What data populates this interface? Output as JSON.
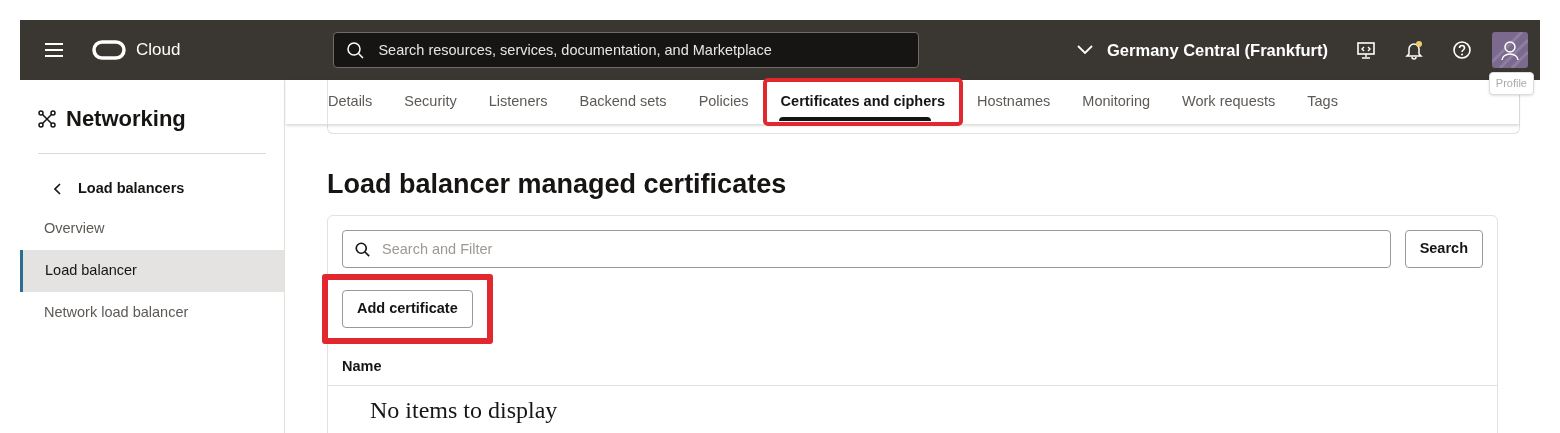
{
  "header": {
    "brand": "Cloud",
    "search": {
      "placeholder": "Search resources, services, documentation, and Marketplace"
    },
    "region": "Germany Central (Frankfurt)",
    "tooltip": "Profile"
  },
  "sidebar": {
    "title": "Networking",
    "back": "Load balancers",
    "items": [
      {
        "label": "Overview",
        "selected": false
      },
      {
        "label": "Load balancer",
        "selected": true
      },
      {
        "label": "Network load balancer",
        "selected": false
      }
    ]
  },
  "tabs": [
    {
      "label": "Details",
      "selected": false,
      "highlighted": false
    },
    {
      "label": "Security",
      "selected": false,
      "highlighted": false
    },
    {
      "label": "Listeners",
      "selected": false,
      "highlighted": false
    },
    {
      "label": "Backend sets",
      "selected": false,
      "highlighted": false
    },
    {
      "label": "Policies",
      "selected": false,
      "highlighted": false
    },
    {
      "label": "Certificates and ciphers",
      "selected": true,
      "highlighted": true
    },
    {
      "label": "Hostnames",
      "selected": false,
      "highlighted": false
    },
    {
      "label": "Monitoring",
      "selected": false,
      "highlighted": false
    },
    {
      "label": "Work requests",
      "selected": false,
      "highlighted": false
    },
    {
      "label": "Tags",
      "selected": false,
      "highlighted": false
    }
  ],
  "section": {
    "title": "Load balancer managed certificates",
    "filter": {
      "placeholder": "Search and Filter"
    },
    "search_button": "Search",
    "add_button": {
      "label": "Add certificate",
      "highlighted": true
    },
    "columns": [
      "Name"
    ],
    "empty": "No items to display"
  }
}
